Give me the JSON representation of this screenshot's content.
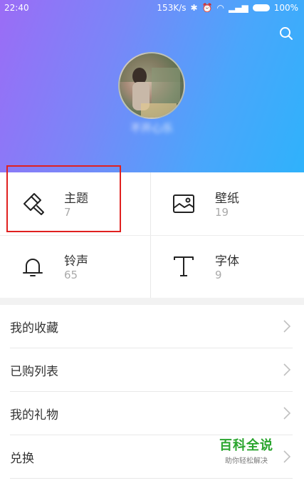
{
  "status": {
    "time": "22:40",
    "speed": "153K/s",
    "battery": "100%"
  },
  "header": {
    "username": "不开心乐"
  },
  "grid": [
    {
      "label": "主题",
      "count": "7",
      "icon": "brush-icon"
    },
    {
      "label": "壁纸",
      "count": "19",
      "icon": "image-icon"
    },
    {
      "label": "铃声",
      "count": "65",
      "icon": "bell-icon"
    },
    {
      "label": "字体",
      "count": "9",
      "icon": "font-icon"
    }
  ],
  "menu": [
    {
      "label": "我的收藏"
    },
    {
      "label": "已购列表"
    },
    {
      "label": "我的礼物"
    },
    {
      "label": "兑换"
    }
  ],
  "watermark": {
    "title": "百科全说",
    "subtitle": "助你轻松解决"
  },
  "colors": {
    "accent_start": "#9b6cf6",
    "accent_end": "#2fb2fb",
    "highlight": "#e0201f",
    "watermark": "#2aa52e"
  }
}
